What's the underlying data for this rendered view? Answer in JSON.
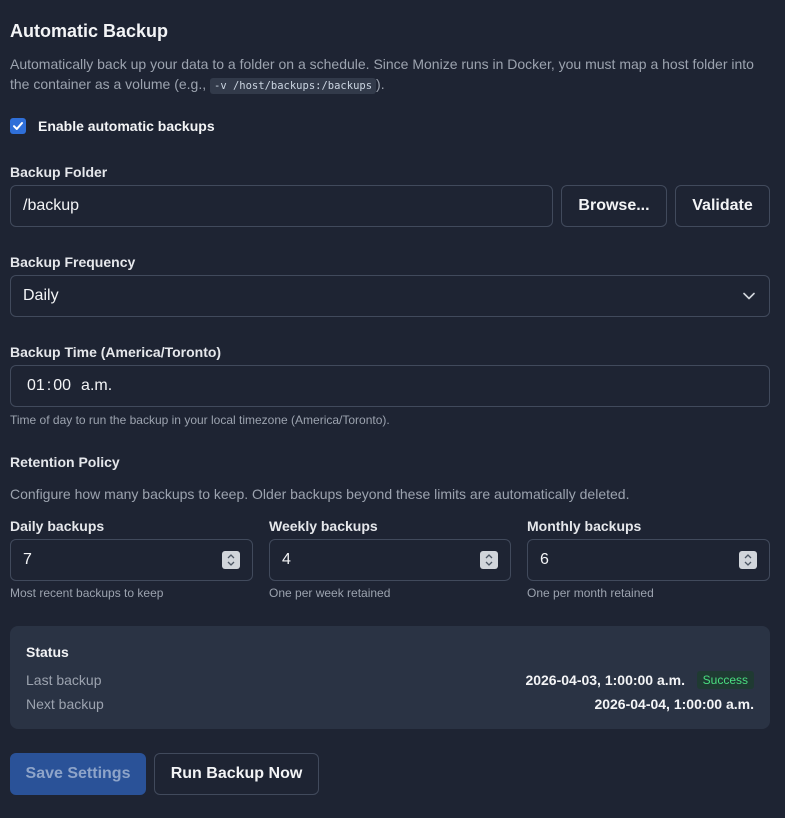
{
  "section": {
    "title": "Automatic Backup",
    "description_part1": "Automatically back up your data to a folder on a schedule. Since Monize runs in Docker, you must map a host folder into the container as a volume (e.g., ",
    "description_code": "-v /host/backups:/backups",
    "description_part2": ")."
  },
  "enable": {
    "label": "Enable automatic backups",
    "checked": true
  },
  "folder": {
    "label": "Backup Folder",
    "value": "/backup",
    "browse_label": "Browse...",
    "validate_label": "Validate"
  },
  "frequency": {
    "label": "Backup Frequency",
    "selected": "Daily"
  },
  "time": {
    "label": "Backup Time (America/Toronto)",
    "hour": "01",
    "minute": "00",
    "period": "a.m.",
    "hint": "Time of day to run the backup in your local timezone (America/Toronto)."
  },
  "retention": {
    "title": "Retention Policy",
    "description": "Configure how many backups to keep. Older backups beyond these limits are automatically deleted.",
    "daily": {
      "label": "Daily backups",
      "value": "7",
      "hint": "Most recent backups to keep"
    },
    "weekly": {
      "label": "Weekly backups",
      "value": "4",
      "hint": "One per week retained"
    },
    "monthly": {
      "label": "Monthly backups",
      "value": "6",
      "hint": "One per month retained"
    }
  },
  "status": {
    "title": "Status",
    "last_label": "Last backup",
    "last_value": "2026-04-03, 1:00:00 a.m.",
    "last_badge": "Success",
    "next_label": "Next backup",
    "next_value": "2026-04-04, 1:00:00 a.m."
  },
  "actions": {
    "save_label": "Save Settings",
    "run_label": "Run Backup Now"
  },
  "colors": {
    "background": "#1e2433",
    "accent": "#2f6fd8",
    "success": "#4ade80"
  }
}
